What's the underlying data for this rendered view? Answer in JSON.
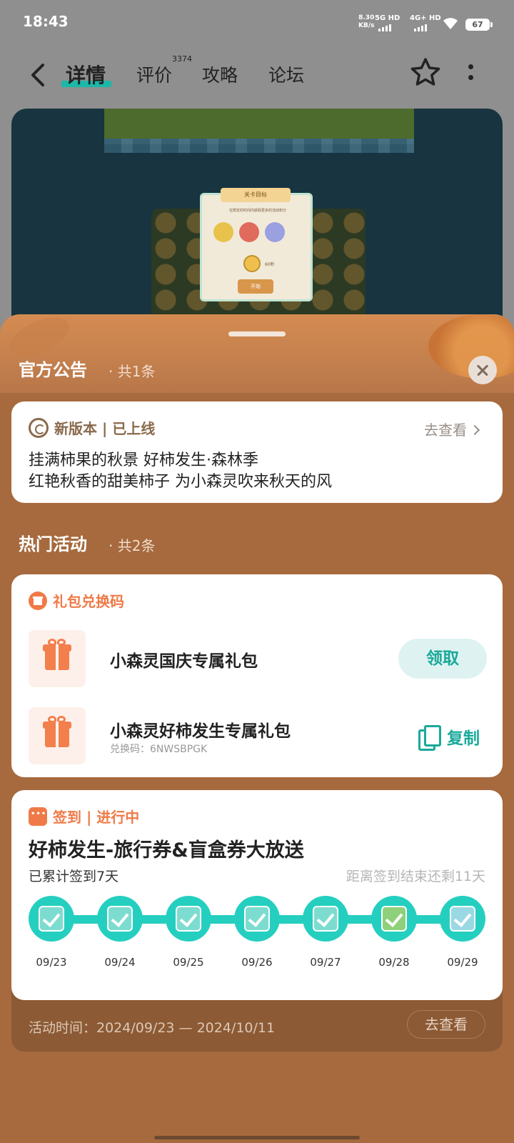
{
  "status_bar": {
    "time": "18:43",
    "net_speed_value": "8.30",
    "net_speed_unit": "KB/s",
    "sim1": "5G HD",
    "sim2": "4G+ HD",
    "battery": "67"
  },
  "nav": {
    "tabs": [
      {
        "label": "详情",
        "active": true
      },
      {
        "label": "评价",
        "count": "3374"
      },
      {
        "label": "攻略"
      },
      {
        "label": "论坛"
      }
    ]
  },
  "hero": {
    "dialog_title": "关卡目标",
    "dialog_desc": "在限定的时间内获取更多的活动积分",
    "dialog_time": "60秒",
    "start_label": "开始"
  },
  "announcement": {
    "title": "官方公告",
    "count": "共1条",
    "tag": "新版本 | 已上线",
    "link": "去查看",
    "lines": [
      "挂满柿果的秋景 好柿发生·森林季",
      "红艳秋香的甜美柿子 为小森灵吹来秋天的风"
    ]
  },
  "activities": {
    "title": "热门活动",
    "count": "共2条",
    "gift": {
      "tag": "礼包兑换码",
      "items": [
        {
          "name": "小森灵国庆专属礼包",
          "action": "领取"
        },
        {
          "name": "小森灵好柿发生专属礼包",
          "code": "兑换码：6NWSBPGK",
          "action": "复制"
        }
      ]
    },
    "checkin": {
      "tag": "签到 | 进行中",
      "title": "好柿发生-旅行券&盲盒券大放送",
      "accumulated": "已累计签到7天",
      "remaining": "距离签到结束还剩11天",
      "days": [
        "09/23",
        "09/24",
        "09/25",
        "09/26",
        "09/27",
        "09/28",
        "09/29"
      ],
      "period": "活动时间：2024/09/23 — 2024/10/11",
      "link": "去查看"
    }
  },
  "colors": {
    "accent": "#1bb8a8",
    "sheet_bg": "#a66a3e",
    "gift_orange": "#ef7a47"
  }
}
